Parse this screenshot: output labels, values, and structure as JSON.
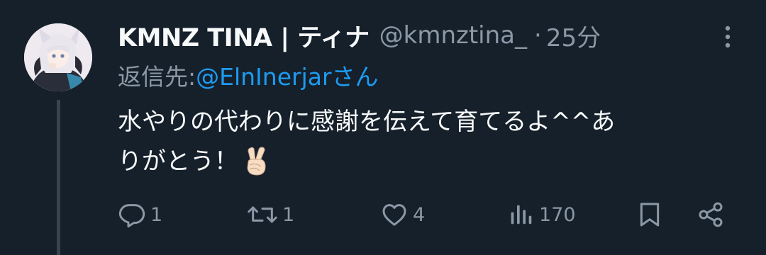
{
  "tweet": {
    "display_name": "KMNZ TINA | ティナ",
    "handle": "@kmnztina_",
    "separator": "·",
    "time": "25分",
    "reply_prefix": "返信先: ",
    "reply_mention": "@ElnInerjarさん",
    "text_line1": "水やりの代わりに感謝を伝えて育てるよ^^あ",
    "text_line2": "りがとう！",
    "emoji": "victory-hand-light-skin-tone"
  },
  "actions": {
    "reply_count": "1",
    "retweet_count": "1",
    "like_count": "4",
    "views_count": "170"
  },
  "colors": {
    "background": "#15202b",
    "primary_text": "#f7f9f9",
    "secondary_text": "#8b98a5",
    "link": "#1d9bf0",
    "thread_line": "#38444d"
  }
}
